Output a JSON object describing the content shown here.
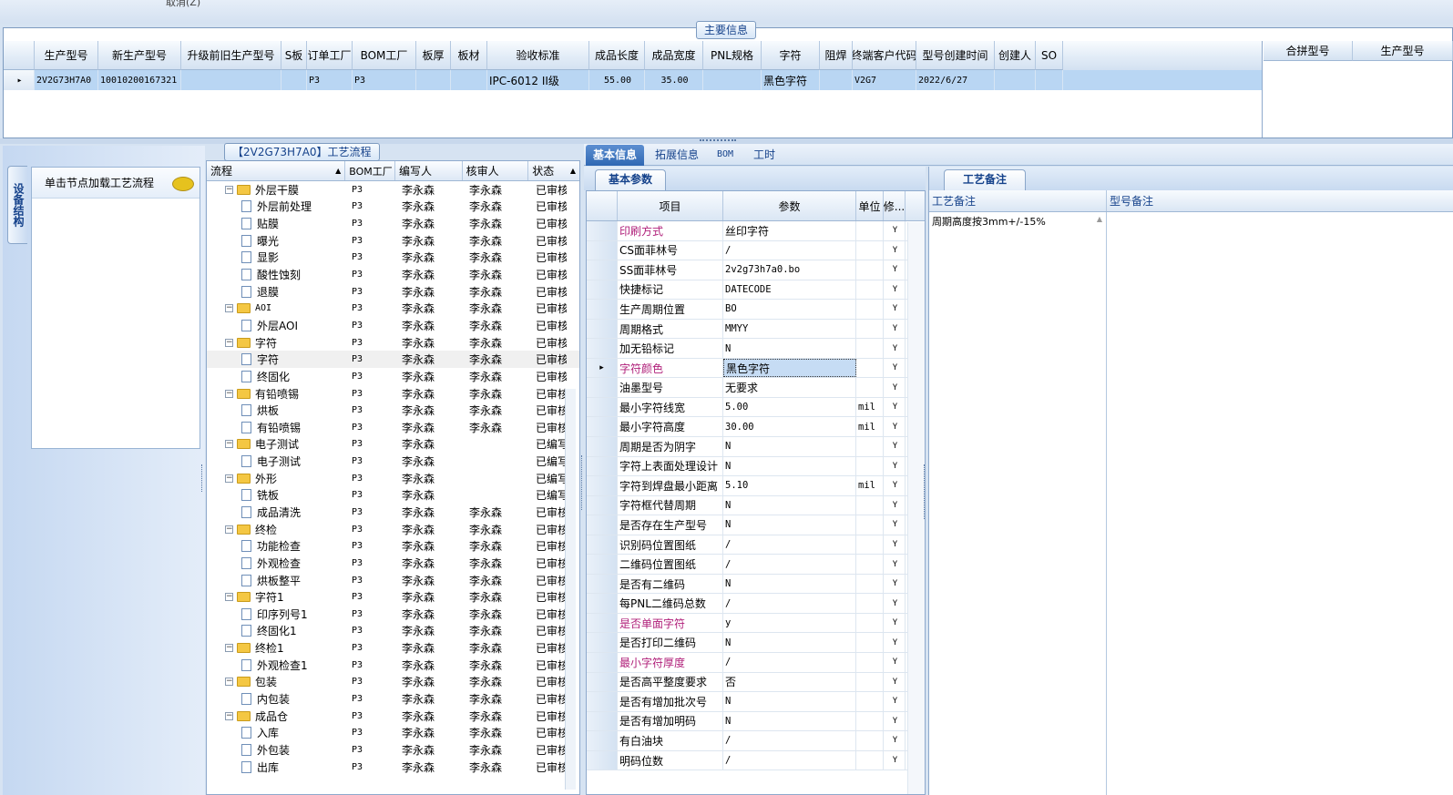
{
  "top_strip_text": "取消(Z)",
  "main_group_title": "主要信息",
  "main_grid": {
    "columns": [
      "生产型号",
      "新生产型号",
      "升级前旧生产型号",
      "S板",
      "订单工厂",
      "BOM工厂",
      "板厚",
      "板材",
      "验收标准",
      "成品长度",
      "成品宽度",
      "PNL规格",
      "字符",
      "阻焊",
      "终端客户代码",
      "型号创建时间",
      "创建人",
      "SO"
    ],
    "rows": [
      {
        "cells": [
          "2V2G73H7A0",
          "10010200167321",
          "",
          "",
          "P3",
          "P3",
          "",
          "",
          "IPC-6012 II级",
          "55.00",
          "35.00",
          "",
          "黑色字符",
          "",
          "V2G7",
          "2022/6/27",
          "",
          ""
        ]
      }
    ]
  },
  "merge_grid": {
    "columns": [
      "合拼型号",
      "生产型号"
    ]
  },
  "left_nav": {
    "vertical_tab": "设备结构",
    "hint": "单击节点加载工艺流程"
  },
  "process_tree": {
    "title": "【2V2G73H7A0】工艺流程",
    "columns": [
      "流程",
      "BOM工厂",
      "编写人",
      "核审人",
      "状态"
    ],
    "rows": [
      {
        "level": 0,
        "type": "folder",
        "name": "外层干膜",
        "bom": "P3",
        "writer": "李永森",
        "reviewer": "李永森",
        "status": "已审核"
      },
      {
        "level": 1,
        "type": "doc",
        "name": "外层前处理",
        "bom": "P3",
        "writer": "李永森",
        "reviewer": "李永森",
        "status": "已审核"
      },
      {
        "level": 1,
        "type": "doc",
        "name": "贴膜",
        "bom": "P3",
        "writer": "李永森",
        "reviewer": "李永森",
        "status": "已审核"
      },
      {
        "level": 1,
        "type": "doc",
        "name": "曝光",
        "bom": "P3",
        "writer": "李永森",
        "reviewer": "李永森",
        "status": "已审核"
      },
      {
        "level": 1,
        "type": "doc",
        "name": "显影",
        "bom": "P3",
        "writer": "李永森",
        "reviewer": "李永森",
        "status": "已审核"
      },
      {
        "level": 1,
        "type": "doc",
        "name": "酸性蚀刻",
        "bom": "P3",
        "writer": "李永森",
        "reviewer": "李永森",
        "status": "已审核"
      },
      {
        "level": 1,
        "type": "doc",
        "name": "退膜",
        "bom": "P3",
        "writer": "李永森",
        "reviewer": "李永森",
        "status": "已审核"
      },
      {
        "level": 0,
        "type": "folder",
        "name": "AOI",
        "bom": "P3",
        "writer": "李永森",
        "reviewer": "李永森",
        "status": "已审核"
      },
      {
        "level": 1,
        "type": "doc",
        "name": "外层AOI",
        "bom": "P3",
        "writer": "李永森",
        "reviewer": "李永森",
        "status": "已审核"
      },
      {
        "level": 0,
        "type": "folder",
        "name": "字符",
        "bom": "P3",
        "writer": "李永森",
        "reviewer": "李永森",
        "status": "已审核"
      },
      {
        "level": 1,
        "type": "doc",
        "name": "字符",
        "bom": "P3",
        "writer": "李永森",
        "reviewer": "李永森",
        "status": "已审核",
        "selected": true
      },
      {
        "level": 1,
        "type": "doc",
        "name": "终固化",
        "bom": "P3",
        "writer": "李永森",
        "reviewer": "李永森",
        "status": "已审核"
      },
      {
        "level": 0,
        "type": "folder",
        "name": "有铅喷锡",
        "bom": "P3",
        "writer": "李永森",
        "reviewer": "李永森",
        "status": "已审核"
      },
      {
        "level": 1,
        "type": "doc",
        "name": "烘板",
        "bom": "P3",
        "writer": "李永森",
        "reviewer": "李永森",
        "status": "已审核"
      },
      {
        "level": 1,
        "type": "doc",
        "name": "有铅喷锡",
        "bom": "P3",
        "writer": "李永森",
        "reviewer": "李永森",
        "status": "已审核"
      },
      {
        "level": 0,
        "type": "folder",
        "name": "电子测试",
        "bom": "P3",
        "writer": "李永森",
        "reviewer": "",
        "status": "已编写"
      },
      {
        "level": 1,
        "type": "doc",
        "name": "电子测试",
        "bom": "P3",
        "writer": "李永森",
        "reviewer": "",
        "status": "已编写"
      },
      {
        "level": 0,
        "type": "folder",
        "name": "外形",
        "bom": "P3",
        "writer": "李永森",
        "reviewer": "",
        "status": "已编写"
      },
      {
        "level": 1,
        "type": "doc",
        "name": "铣板",
        "bom": "P3",
        "writer": "李永森",
        "reviewer": "",
        "status": "已编写"
      },
      {
        "level": 1,
        "type": "doc",
        "name": "成品清洗",
        "bom": "P3",
        "writer": "李永森",
        "reviewer": "李永森",
        "status": "已审核"
      },
      {
        "level": 0,
        "type": "folder",
        "name": "终检",
        "bom": "P3",
        "writer": "李永森",
        "reviewer": "李永森",
        "status": "已审核"
      },
      {
        "level": 1,
        "type": "doc",
        "name": "功能检查",
        "bom": "P3",
        "writer": "李永森",
        "reviewer": "李永森",
        "status": "已审核"
      },
      {
        "level": 1,
        "type": "doc",
        "name": "外观检查",
        "bom": "P3",
        "writer": "李永森",
        "reviewer": "李永森",
        "status": "已审核"
      },
      {
        "level": 1,
        "type": "doc",
        "name": "烘板整平",
        "bom": "P3",
        "writer": "李永森",
        "reviewer": "李永森",
        "status": "已审核"
      },
      {
        "level": 0,
        "type": "folder",
        "name": "字符1",
        "bom": "P3",
        "writer": "李永森",
        "reviewer": "李永森",
        "status": "已审核"
      },
      {
        "level": 1,
        "type": "doc",
        "name": "印序列号1",
        "bom": "P3",
        "writer": "李永森",
        "reviewer": "李永森",
        "status": "已审核"
      },
      {
        "level": 1,
        "type": "doc",
        "name": "终固化1",
        "bom": "P3",
        "writer": "李永森",
        "reviewer": "李永森",
        "status": "已审核"
      },
      {
        "level": 0,
        "type": "folder",
        "name": "终检1",
        "bom": "P3",
        "writer": "李永森",
        "reviewer": "李永森",
        "status": "已审核"
      },
      {
        "level": 1,
        "type": "doc",
        "name": "外观检查1",
        "bom": "P3",
        "writer": "李永森",
        "reviewer": "李永森",
        "status": "已审核"
      },
      {
        "level": 0,
        "type": "folder",
        "name": "包装",
        "bom": "P3",
        "writer": "李永森",
        "reviewer": "李永森",
        "status": "已审核"
      },
      {
        "level": 1,
        "type": "doc",
        "name": "内包装",
        "bom": "P3",
        "writer": "李永森",
        "reviewer": "李永森",
        "status": "已审核"
      },
      {
        "level": 0,
        "type": "folder",
        "name": "成品仓",
        "bom": "P3",
        "writer": "李永森",
        "reviewer": "李永森",
        "status": "已审核"
      },
      {
        "level": 1,
        "type": "doc",
        "name": "入库",
        "bom": "P3",
        "writer": "李永森",
        "reviewer": "李永森",
        "status": "已审核"
      },
      {
        "level": 1,
        "type": "doc",
        "name": "外包装",
        "bom": "P3",
        "writer": "李永森",
        "reviewer": "李永森",
        "status": "已审核"
      },
      {
        "level": 1,
        "type": "doc",
        "name": "出库",
        "bom": "P3",
        "writer": "李永森",
        "reviewer": "李永森",
        "status": "已审核"
      }
    ]
  },
  "tabs": [
    "基本信息",
    "拓展信息",
    "BOM",
    "工时"
  ],
  "active_tab": "基本信息",
  "basic_params": {
    "subtab": "基本参数",
    "columns": [
      "项目",
      "参数",
      "单位",
      "修..."
    ],
    "rows": [
      {
        "item": "印刷方式",
        "value": "丝印字符",
        "unit": "",
        "mod": "Y",
        "pink": true
      },
      {
        "item": "CS面菲林号",
        "value": "/",
        "unit": "",
        "mod": "Y"
      },
      {
        "item": "SS面菲林号",
        "value": "2v2g73h7a0.bo",
        "unit": "",
        "mod": "Y"
      },
      {
        "item": "快捷标记",
        "value": "DATECODE",
        "unit": "",
        "mod": "Y"
      },
      {
        "item": "生产周期位置",
        "value": "BO",
        "unit": "",
        "mod": "Y"
      },
      {
        "item": "周期格式",
        "value": "MMYY",
        "unit": "",
        "mod": "Y"
      },
      {
        "item": "加无铅标记",
        "value": "N",
        "unit": "",
        "mod": "Y"
      },
      {
        "item": "字符颜色",
        "value": "黑色字符",
        "unit": "",
        "mod": "Y",
        "pink": true,
        "selected": true
      },
      {
        "item": "油墨型号",
        "value": "无要求",
        "unit": "",
        "mod": "Y"
      },
      {
        "item": "最小字符线宽",
        "value": "5.00",
        "unit": "mil",
        "mod": "Y"
      },
      {
        "item": "最小字符高度",
        "value": "30.00",
        "unit": "mil",
        "mod": "Y"
      },
      {
        "item": "周期是否为阴字",
        "value": "N",
        "unit": "",
        "mod": "Y"
      },
      {
        "item": "字符上表面处理设计",
        "value": "N",
        "unit": "",
        "mod": "Y"
      },
      {
        "item": "字符到焊盘最小距离",
        "value": "5.10",
        "unit": "mil",
        "mod": "Y"
      },
      {
        "item": "字符框代替周期",
        "value": "N",
        "unit": "",
        "mod": "Y"
      },
      {
        "item": "是否存在生产型号",
        "value": "N",
        "unit": "",
        "mod": "Y"
      },
      {
        "item": "识别码位置图纸",
        "value": "/",
        "unit": "",
        "mod": "Y"
      },
      {
        "item": "二维码位置图纸",
        "value": "/",
        "unit": "",
        "mod": "Y"
      },
      {
        "item": "是否有二维码",
        "value": "N",
        "unit": "",
        "mod": "Y"
      },
      {
        "item": "每PNL二维码总数",
        "value": "/",
        "unit": "",
        "mod": "Y"
      },
      {
        "item": "是否单面字符",
        "value": "y",
        "unit": "",
        "mod": "Y",
        "pink": true
      },
      {
        "item": "是否打印二维码",
        "value": "N",
        "unit": "",
        "mod": "Y"
      },
      {
        "item": "最小字符厚度",
        "value": "/",
        "unit": "",
        "mod": "Y",
        "pink": true
      },
      {
        "item": "是否高平整度要求",
        "value": "否",
        "unit": "",
        "mod": "Y"
      },
      {
        "item": "是否有增加批次号",
        "value": "N",
        "unit": "",
        "mod": "Y"
      },
      {
        "item": "是否有增加明码",
        "value": "N",
        "unit": "",
        "mod": "Y"
      },
      {
        "item": "有白油块",
        "value": "/",
        "unit": "",
        "mod": "Y"
      },
      {
        "item": "明码位数",
        "value": "/",
        "unit": "",
        "mod": "Y"
      }
    ]
  },
  "remarks": {
    "subtab": "工艺备注",
    "columns": [
      "工艺备注",
      "型号备注"
    ],
    "process_note": "周期高度按3mm+/-15%",
    "model_note": ""
  },
  "colors": {
    "accent": "#2f68b3",
    "pink": "#b0207a",
    "selected_row": "#b9d6f3"
  }
}
